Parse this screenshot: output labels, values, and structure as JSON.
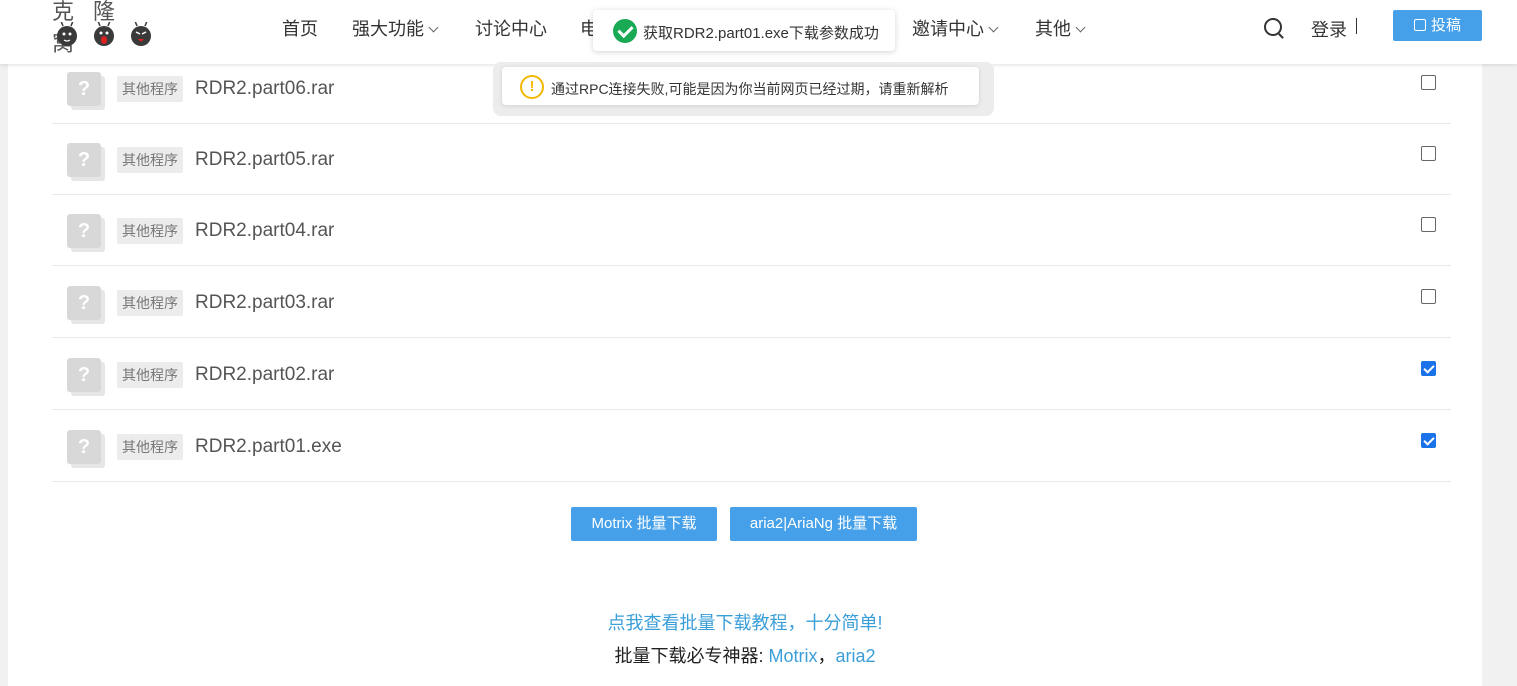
{
  "header": {
    "logo_text": "克隆窝",
    "nav": [
      {
        "label": "首页",
        "has_dropdown": false
      },
      {
        "label": "强大功能",
        "has_dropdown": true
      },
      {
        "label": "讨论中心",
        "has_dropdown": false
      },
      {
        "label": "电",
        "has_dropdown": false
      },
      {
        "label": "邀请中心",
        "has_dropdown": true
      },
      {
        "label": "其他",
        "has_dropdown": true
      }
    ],
    "login_label": "登录",
    "submit_label": "投稿"
  },
  "files": [
    {
      "tag": "其他程序",
      "name": "RDR2.part06.rar",
      "checked": false
    },
    {
      "tag": "其他程序",
      "name": "RDR2.part05.rar",
      "checked": false
    },
    {
      "tag": "其他程序",
      "name": "RDR2.part04.rar",
      "checked": false
    },
    {
      "tag": "其他程序",
      "name": "RDR2.part03.rar",
      "checked": false
    },
    {
      "tag": "其他程序",
      "name": "RDR2.part02.rar",
      "checked": true
    },
    {
      "tag": "其他程序",
      "name": "RDR2.part01.exe",
      "checked": true
    }
  ],
  "file_icon_glyph": "?",
  "buttons": {
    "motrix": "Motrix 批量下载",
    "aria2": "aria2|AriaNg 批量下载"
  },
  "tutorial_link": "点我查看批量下载教程，十分简单!",
  "tools": {
    "prefix": "批量下载必专神器: ",
    "motrix": "Motrix",
    "separator": "，",
    "aria2": "aria2"
  },
  "toasts": {
    "success": "获取RDR2.part01.exe下载参数成功",
    "warning": "通过RPC连接失败,可能是因为你当前网页已经过期，请重新解析",
    "warning_glyph": "!"
  },
  "colors": {
    "accent": "#45a0e9",
    "link": "#3a9ed8",
    "success": "#1aaa55",
    "warning": "#f5b800",
    "checkbox": "#1a73e8"
  }
}
